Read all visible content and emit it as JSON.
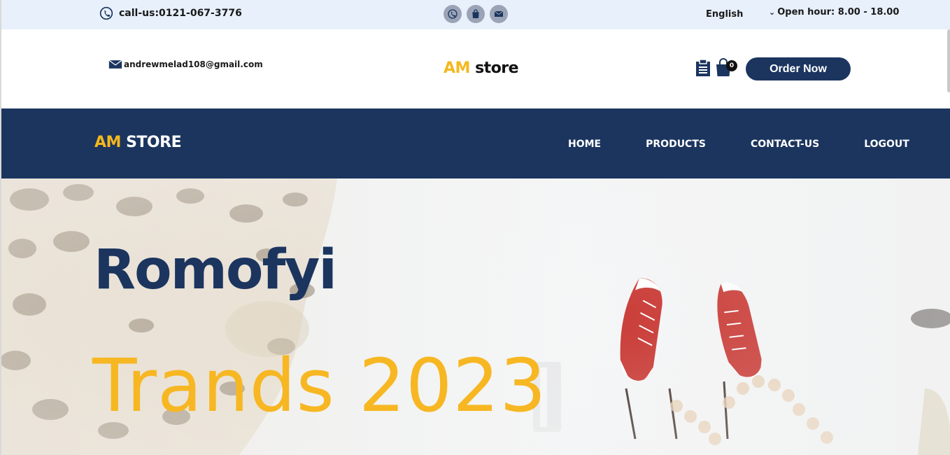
{
  "topbar": {
    "phone_text": "call-us:0121-067-3776",
    "social_icons": [
      "phone-icon",
      "shopping-bag-icon",
      "mail-icon"
    ],
    "language": "English",
    "hours": "Open hour: 8.00 - 18.00"
  },
  "header": {
    "email": "andrewmelad108@gmail.com",
    "logo_am": "AM",
    "logo_rest": " store",
    "cart_count": "0",
    "order_button": "Order Now"
  },
  "nav": {
    "logo_am": "AM",
    "logo_rest": " STORE",
    "links": [
      "HOME",
      "PRODUCTS",
      "CONTACT-US",
      "LOGOUT"
    ]
  },
  "hero": {
    "title": "Romofyi",
    "subtitle": "Trands 2023"
  },
  "colors": {
    "navy": "#1b355f",
    "accent_yellow": "#f4b81d",
    "topbar_bg": "#e8f0fb"
  }
}
